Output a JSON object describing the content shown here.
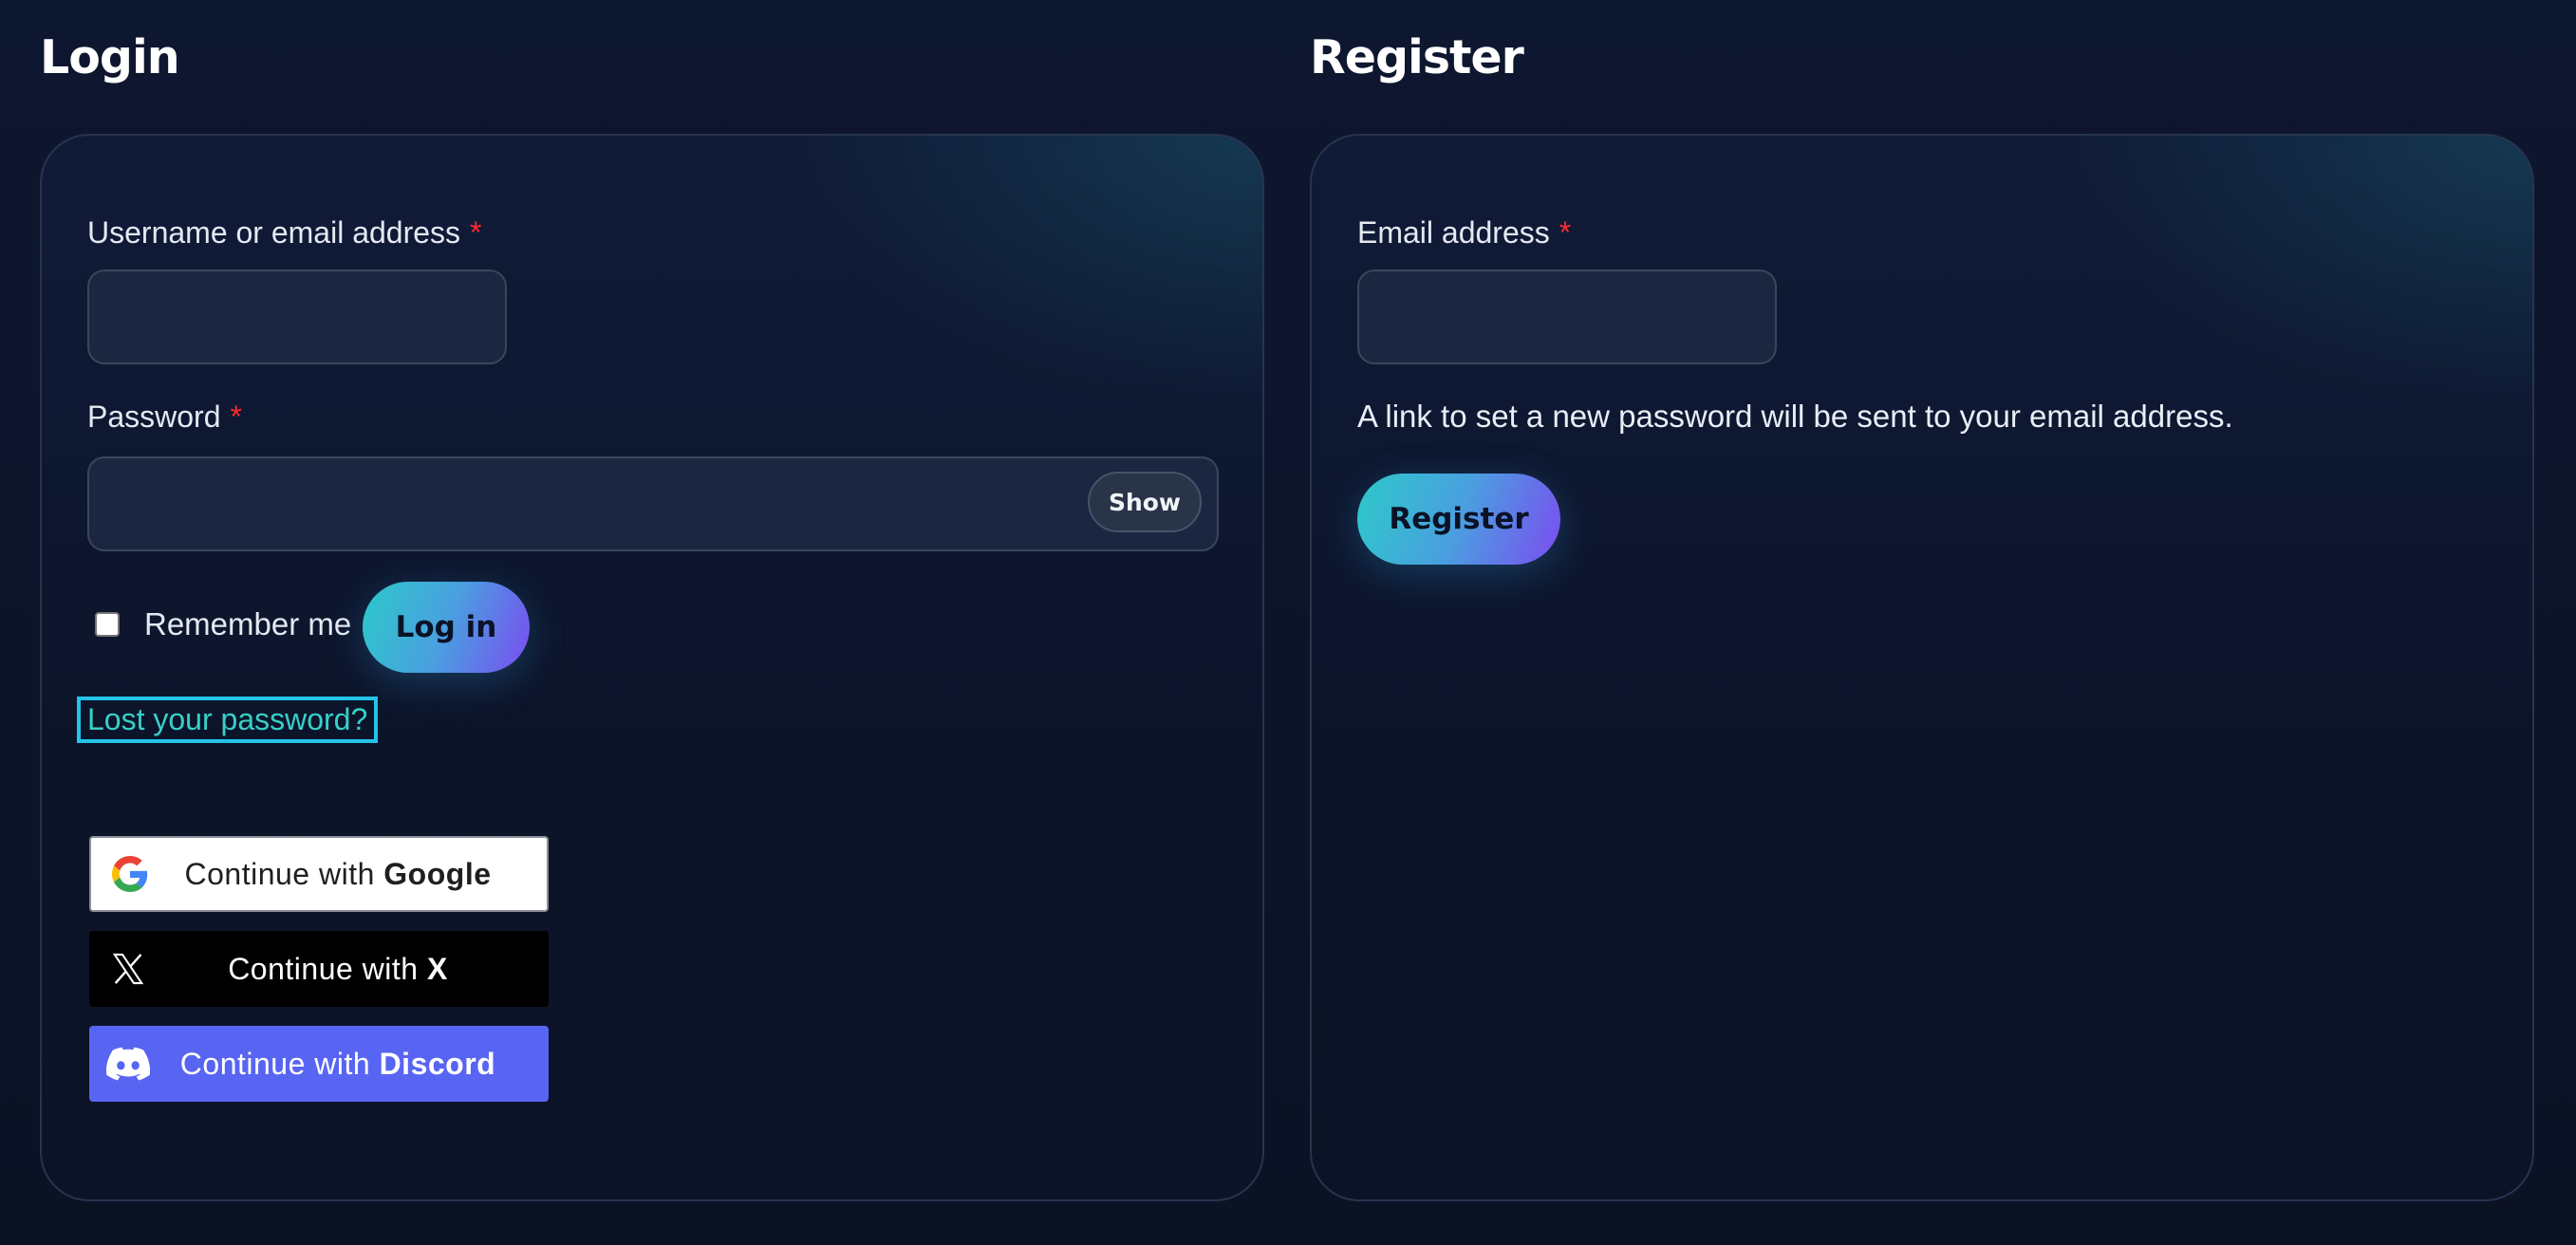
{
  "login": {
    "title": "Login",
    "username_label": "Username or email address",
    "required_mark": "*",
    "password_label": "Password",
    "show_label": "Show",
    "remember_label": "Remember me",
    "login_button": "Log in",
    "lost_password": "Lost your password?",
    "social": {
      "prefix": "Continue with",
      "google": "Google",
      "x": "X",
      "discord": "Discord"
    }
  },
  "register": {
    "title": "Register",
    "email_label": "Email address",
    "required_mark": "*",
    "note": "A link to set a new password will be sent to your email address.",
    "register_button": "Register"
  },
  "colors": {
    "accent": "#22c4e8",
    "link": "#37d0c7",
    "required": "#ff2a2a",
    "discord": "#5865f2"
  },
  "icons": [
    "google-icon",
    "x-icon",
    "discord-icon"
  ]
}
